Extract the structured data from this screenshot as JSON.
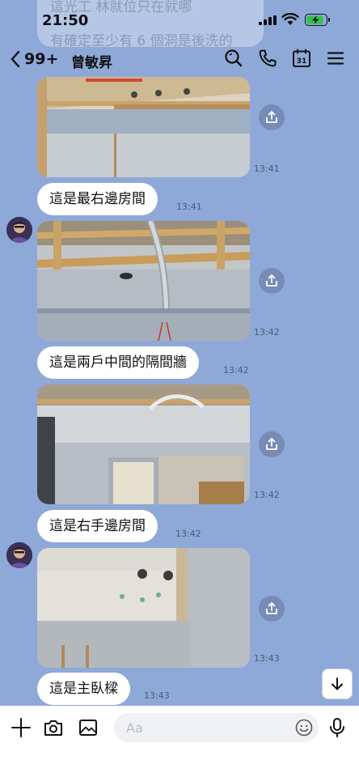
{
  "status": {
    "time": "21:50"
  },
  "header": {
    "back_count": "99+",
    "contact_name": "曾敏昇",
    "calendar_day": "31"
  },
  "previous_message": {
    "line1": "這光工 林就位只在就哪",
    "line2": "有確定至少有 6 個洞是後洗的"
  },
  "messages": [
    {
      "type": "image",
      "time": "13:41"
    },
    {
      "type": "text",
      "text": "這是最右邊房間",
      "time": "13:41"
    },
    {
      "type": "image",
      "time": "13:42"
    },
    {
      "type": "text",
      "text": "這是兩戶中間的隔間牆",
      "time": "13:42"
    },
    {
      "type": "image",
      "time": "13:42"
    },
    {
      "type": "text",
      "text": "這是右手邊房間",
      "time": "13:42"
    },
    {
      "type": "image",
      "time": "13:43"
    },
    {
      "type": "text",
      "text": "這是主臥樑",
      "time": "13:43"
    }
  ],
  "input": {
    "placeholder": "Aa"
  },
  "colors": {
    "chat_background": "#8ea9d8",
    "bubble": "#ffffff",
    "accent": "#06c755"
  }
}
